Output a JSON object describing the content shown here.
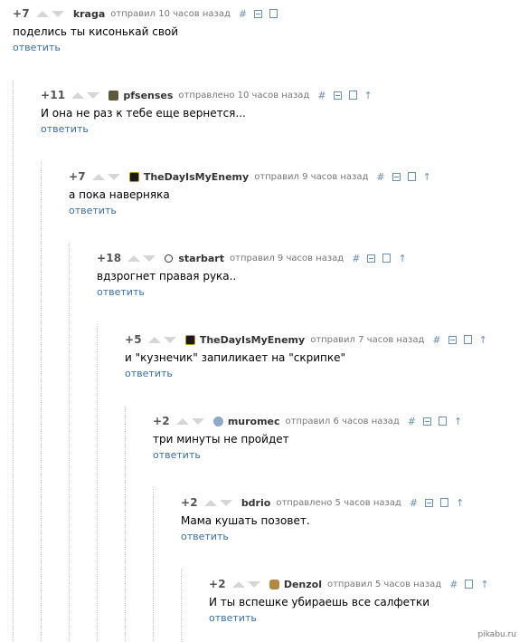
{
  "comments": [
    {
      "rating": "+7",
      "author": "kraga",
      "time": "отправил 10 часов назад",
      "text": "поделись ты кисонькай свой",
      "reply": "ответить",
      "has_up": false,
      "avatar": ""
    },
    {
      "rating": "+11",
      "author": "pfsenses",
      "time": "отправлено 10 часов назад",
      "text": "И она не раз к тебе еще вернется...",
      "reply": "ответить",
      "has_up": true,
      "avatar": "pfs"
    },
    {
      "rating": "+7",
      "author": "TheDayIsMyEnemy",
      "time": "отправил 9 часов назад",
      "text": "а пока наверняка",
      "reply": "ответить",
      "has_up": true,
      "avatar": "tdm"
    },
    {
      "rating": "+18",
      "author": "starbart",
      "time": "отправил 9 часов назад",
      "text": "вдзрогнет правая рука..",
      "reply": "ответить",
      "has_up": true,
      "avatar": "star"
    },
    {
      "rating": "+5",
      "author": "TheDayIsMyEnemy",
      "time": "отправил 7 часов назад",
      "text": "и \"кузнечик\" запиликает на \"скрипке\"",
      "reply": "ответить",
      "has_up": true,
      "avatar": "tdm"
    },
    {
      "rating": "+2",
      "author": "muromec",
      "time": "отправил 6 часов назад",
      "text": "три минуты не пройдет",
      "reply": "ответить",
      "has_up": true,
      "avatar": "muro"
    },
    {
      "rating": "+2",
      "author": "bdrio",
      "time": "отправлено 5 часов назад",
      "text": "Мама кушать позовет.",
      "reply": "ответить",
      "has_up": true,
      "avatar": ""
    },
    {
      "rating": "+2",
      "author": "Denzol",
      "time": "отправил 5 часов назад",
      "text": "И ты вспешке убираешь все салфетки",
      "reply": "ответить",
      "has_up": true,
      "avatar": "denz",
      "has_box": false
    }
  ],
  "icons": {
    "link": "#",
    "collapse": "collapse-icon",
    "save": "save-icon",
    "up": "↑"
  },
  "watermark": "pikabu.ru"
}
